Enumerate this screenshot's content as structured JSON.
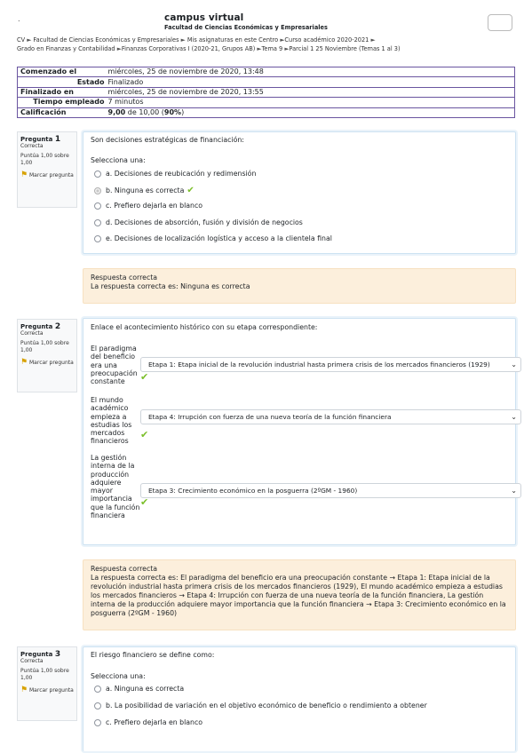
{
  "header": {
    "dot": ".",
    "site_title": "campus virtual",
    "site_subtitle": "Facultad de Ciencias Económicas y Empresariales",
    "breadcrumb": [
      "CV",
      "Facultad de Ciencias Económicas y Empresariales",
      "Mis asignaturas en este Centro",
      "Curso académico 2020-2021",
      "Grado en Finanzas y Contabilidad",
      "Finanzas Corporativas I (2020-21, Grupos AB)",
      "Tema 9",
      "Parcial 1 25 Noviembre (Temas 1 al 3)"
    ],
    "separator": "►"
  },
  "summary": {
    "started_label": "Comenzado el",
    "started_value": "miércoles, 25 de noviembre de 2020, 13:48",
    "state_label": "Estado",
    "state_value": "Finalizado",
    "finished_label": "Finalizado en",
    "finished_value": "miércoles, 25 de noviembre de 2020, 13:55",
    "time_label": "Tiempo empleado",
    "time_value": "7 minutos",
    "grade_label": "Calificación",
    "grade_value_bold": "9,00",
    "grade_value_mid": " de 10,00 (",
    "grade_value_pct": "90%",
    "grade_value_end": ")"
  },
  "questions": [
    {
      "label": "Pregunta",
      "number": "1",
      "status": "Correcta",
      "score": "Puntúa 1,00 sobre 1,00",
      "flag_label": "Marcar pregunta",
      "text": "Son decisiones estratégicas de financiación:",
      "prompt": "Selecciona una:",
      "options": [
        "a. Decisiones de reubicación y redimensión",
        "b. Ninguna es correcta",
        "c. Prefiero dejarla en blanco",
        "d. Decisiones de absorción, fusión y división de negocios",
        "e. Decisiones de localización logística y acceso a la clientela final"
      ],
      "feedback_title": "Respuesta correcta",
      "feedback_text": "La respuesta correcta es: Ninguna es correcta"
    },
    {
      "label": "Pregunta",
      "number": "2",
      "status": "Correcta",
      "score": "Puntúa 1,00 sobre 1,00",
      "flag_label": "Marcar pregunta",
      "text": "Enlace el acontecimiento histórico con su etapa correspondiente:",
      "items": [
        {
          "label": "El paradigma del beneficio era una preocupación constante",
          "selected": "Etapa 1: Etapa inicial de la revolución industrial hasta primera crisis de los mercados financieros (1929)"
        },
        {
          "label": "El mundo académico empieza a estudias los mercados financieros",
          "selected": "Etapa 4: Irrupción con fuerza de una nueva teoría de la función financiera"
        },
        {
          "label": "La gestión interna de la producción adquiere mayor importancia que la función financiera",
          "selected": "Etapa 3: Crecimiento económico en la posguerra (2ºGM - 1960)"
        }
      ],
      "feedback_title": "Respuesta correcta",
      "feedback_text": "La respuesta correcta es: El paradigma del beneficio era una preocupación constante  → Etapa 1: Etapa inicial de la revolución industrial hasta primera crisis de los mercados financieros (1929), El mundo académico empieza a estudias los mercados financieros  → Etapa 4: Irrupción con fuerza de una nueva teoría de la función financiera, La gestión interna de la producción adquiere mayor importancia que la función financiera  → Etapa 3: Crecimiento económico en la posguerra (2ºGM - 1960)"
    },
    {
      "label": "Pregunta",
      "number": "3",
      "status": "Correcta",
      "score": "Puntúa 1,00 sobre 1,00",
      "flag_label": "Marcar pregunta",
      "text": "El riesgo financiero se define como:",
      "prompt": "Selecciona una:",
      "options": [
        "a. Ninguna es correcta",
        "b. La posibilidad de variación en el objetivo económico de beneficio o rendimiento a obtener",
        "c. Prefiero dejarla en blanco"
      ]
    }
  ],
  "icons": {
    "flag": "flag-icon",
    "check": "check-icon",
    "chevron": "chevron-down-icon"
  },
  "colors": {
    "correct_check": "#7bbf2a",
    "feedback_bg": "#fcefdc",
    "table_border": "#6a55a0"
  }
}
